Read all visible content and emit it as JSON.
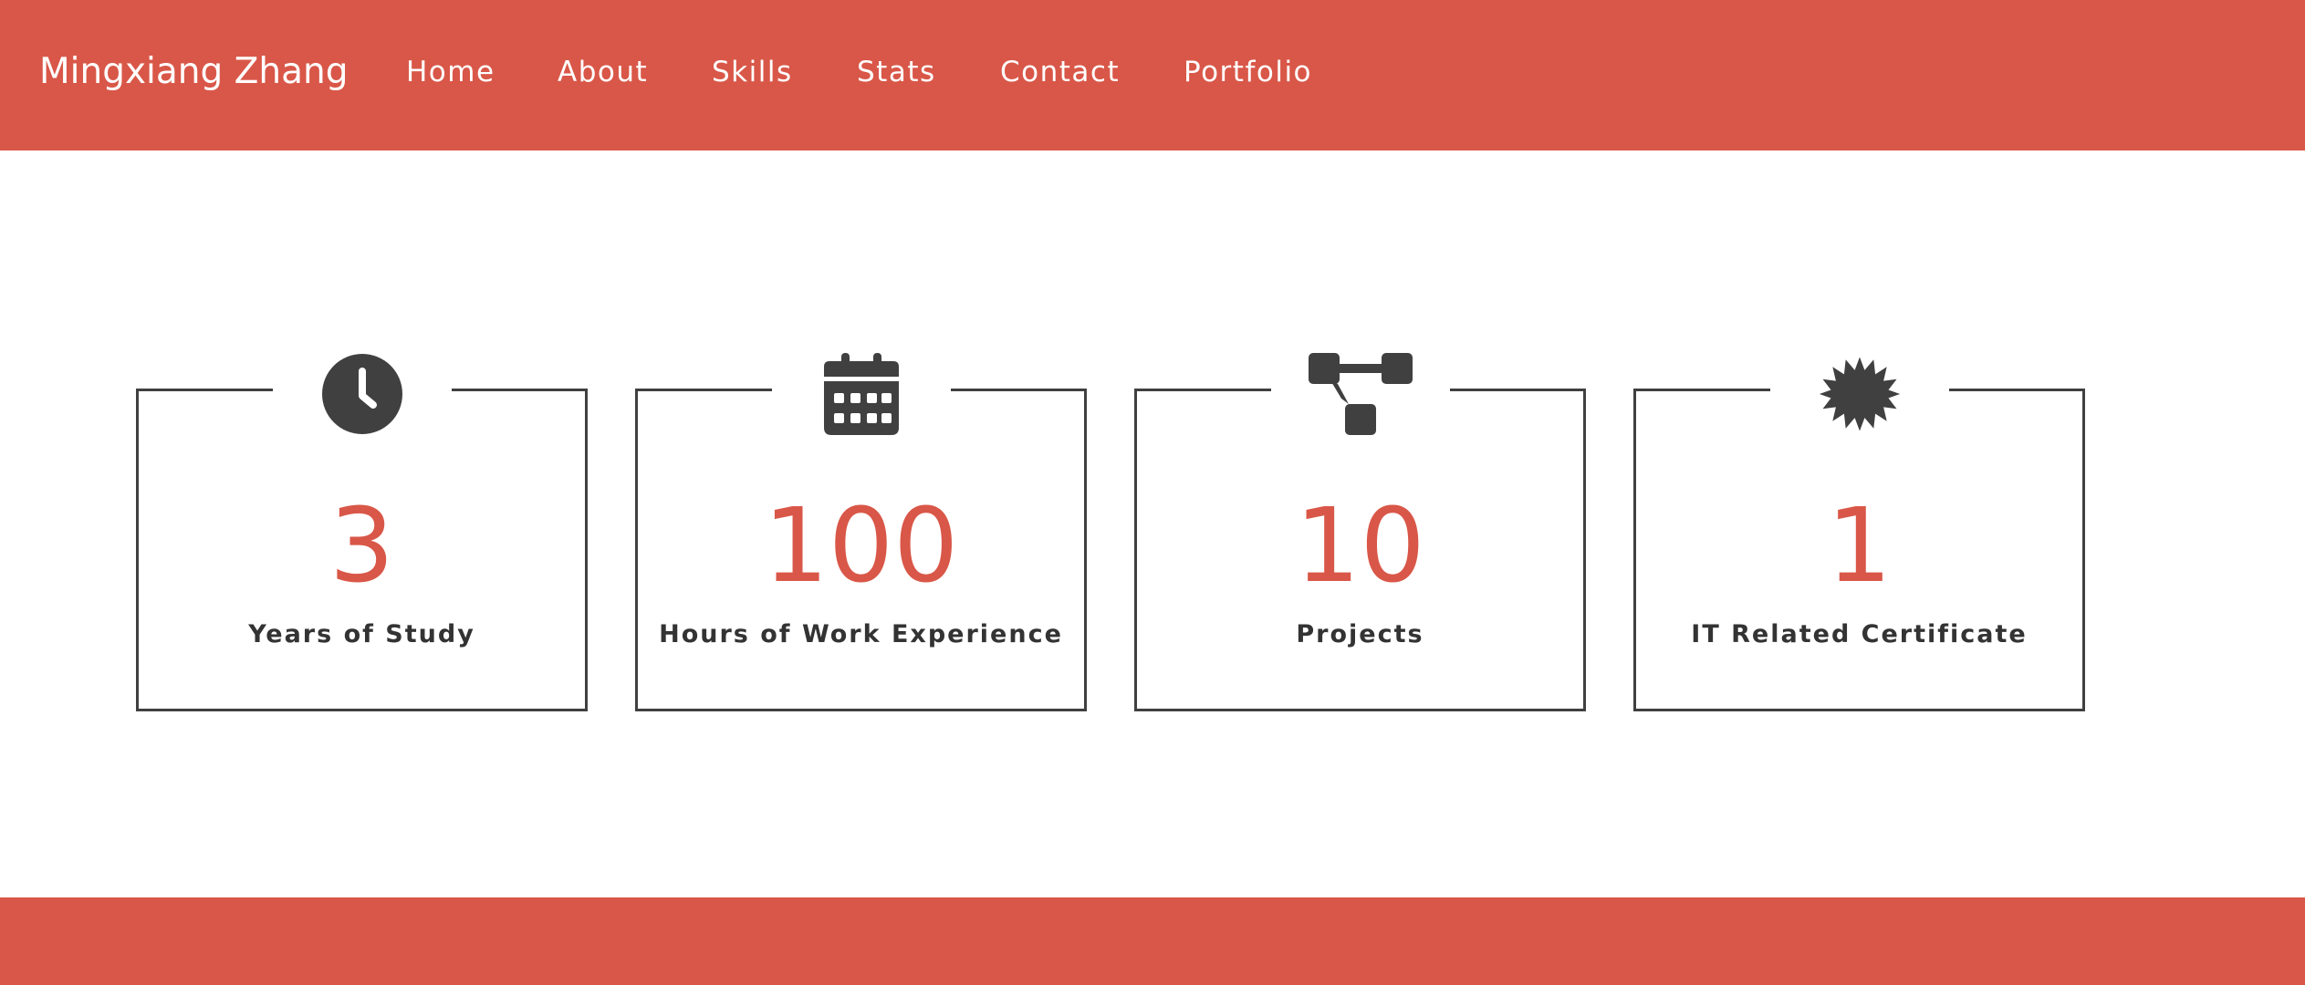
{
  "header": {
    "brand": "Mingxiang Zhang",
    "nav": [
      {
        "label": "Home"
      },
      {
        "label": "About"
      },
      {
        "label": "Skills"
      },
      {
        "label": "Stats"
      },
      {
        "label": "Contact"
      },
      {
        "label": "Portfolio"
      }
    ]
  },
  "stats": [
    {
      "icon": "clock-icon",
      "value": "3",
      "label": "Years of Study"
    },
    {
      "icon": "calendar-icon",
      "value": "100",
      "label": "Hours of Work Experience"
    },
    {
      "icon": "project-diagram-icon",
      "value": "10",
      "label": "Projects"
    },
    {
      "icon": "certificate-icon",
      "value": "1",
      "label": "IT Related Certificate"
    }
  ],
  "colors": {
    "accent": "#d95748",
    "dark": "#404040",
    "label": "#333333",
    "background": "#ffffff"
  }
}
